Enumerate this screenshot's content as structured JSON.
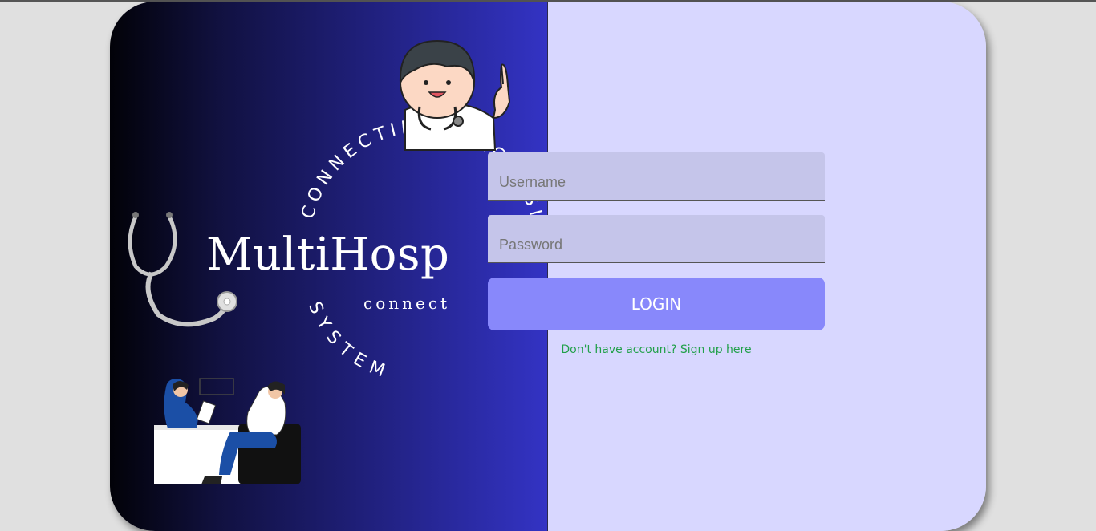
{
  "brand": {
    "name": "MultiHosp",
    "tagline": "connect",
    "circle_text_top": "CONNECTING DIAGNOSIS",
    "circle_text_bottom": "SYSTEM"
  },
  "login_form": {
    "username_placeholder": "Username",
    "password_placeholder": "Password",
    "login_label": "LOGIN",
    "signup_link": "Don't have account? Sign up here"
  },
  "colors": {
    "panel_right": "#d8d7ff",
    "input_bg": "#c5c5ea",
    "button": "#8888fb",
    "link": "#22a04a",
    "gradient_end": "#3333c4"
  },
  "illustrations": [
    "doctor-cartoon-icon",
    "stethoscope-icon",
    "consultation-illustration"
  ]
}
